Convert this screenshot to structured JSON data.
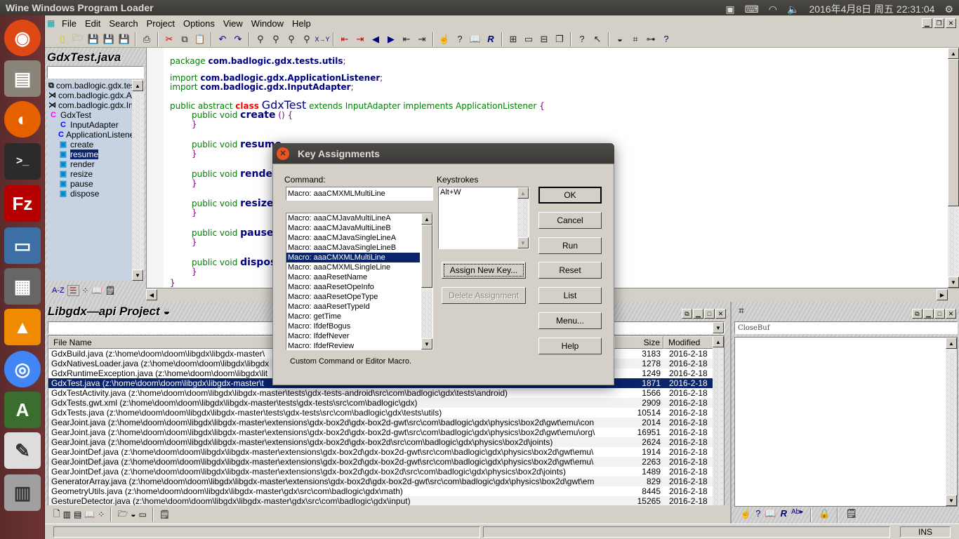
{
  "os": {
    "window_title": "Wine Windows Program Loader",
    "clock": "2016年4月8日 周五 22:31:04",
    "launcher_icons": [
      "ubuntu-dash",
      "files",
      "firefox",
      "terminal",
      "filezilla",
      "remote-desktop",
      "calculator",
      "vlc",
      "chromium",
      "software-updater",
      "text-editor",
      "wine"
    ]
  },
  "menubar": {
    "items": [
      "File",
      "Edit",
      "Search",
      "Project",
      "Options",
      "View",
      "Window",
      "Help"
    ]
  },
  "toolbar": {
    "icons": [
      "new-file",
      "open-folder",
      "save",
      "save-as",
      "save-all",
      "print",
      "cut",
      "copy",
      "paste",
      "undo",
      "redo",
      "find",
      "find-prev",
      "find-next",
      "find-in-files",
      "replace",
      "jump-prev",
      "jump-next",
      "back",
      "forward",
      "outdent",
      "indent",
      "bookmark",
      "help",
      "book",
      "regex",
      "tile",
      "window",
      "split-h",
      "split-v",
      "context-help",
      "pointer",
      "project",
      "relation",
      "hierarchy",
      "info"
    ]
  },
  "symbol_panel": {
    "title": "GdxTest.java",
    "search_value": "",
    "items": [
      {
        "icon": "package",
        "label": "com.badlogic.gdx.tests.utils",
        "indent": 0
      },
      {
        "icon": "import",
        "label": "com.badlogic.gdx.ApplicationListener",
        "indent": 0
      },
      {
        "icon": "import",
        "label": "com.badlogic.gdx.InputAdapter",
        "indent": 0
      },
      {
        "icon": "class-magenta",
        "label": "GdxTest",
        "indent": 0
      },
      {
        "icon": "class",
        "label": "InputAdapter",
        "indent": 1
      },
      {
        "icon": "class",
        "label": "ApplicationListener",
        "indent": 1
      },
      {
        "icon": "method",
        "label": "create",
        "indent": 1
      },
      {
        "icon": "method",
        "label": "resume",
        "indent": 1,
        "selected": true
      },
      {
        "icon": "method",
        "label": "render",
        "indent": 1
      },
      {
        "icon": "method",
        "label": "resize",
        "indent": 1
      },
      {
        "icon": "method",
        "label": "pause",
        "indent": 1
      },
      {
        "icon": "method",
        "label": "dispose",
        "indent": 1
      }
    ],
    "bottom_icons": [
      "sort-az",
      "list-view",
      "categories",
      "book",
      "properties"
    ],
    "sort_label": "A-Z"
  },
  "editor": {
    "package_kw": "package",
    "package_name": "com.badlogic.gdx.tests.utils",
    "import_kw": "import",
    "imports": [
      "com.badlogic.gdx.ApplicationListener",
      "com.badlogic.gdx.InputAdapter"
    ],
    "class_prefix": "public abstract",
    "class_kw": "class",
    "class_name": "GdxTest",
    "class_suffix": "extends InputAdapter implements ApplicationListener",
    "method_prefix": "public void",
    "methods": [
      "create",
      "resume",
      "render",
      "resize",
      "pause",
      "dispose"
    ],
    "first_args": "() {"
  },
  "project_panel": {
    "title": "Libgdx—api Project",
    "filter_value": "",
    "columns": [
      "File Name",
      "Size",
      "Modified"
    ],
    "rows": [
      {
        "name": "GdxBuild.java (z:\\home\\doom\\doom\\libgdx\\libgdx-master\\",
        "size": "3183",
        "modified": "2016-2-18"
      },
      {
        "name": "GdxNativesLoader.java (z:\\home\\doom\\doom\\libgdx\\libgdx",
        "size": "1278",
        "modified": "2016-2-18"
      },
      {
        "name": "GdxRuntimeException.java (z:\\home\\doom\\doom\\libgdx\\lit",
        "size": "1249",
        "modified": "2016-2-18"
      },
      {
        "name": "GdxTest.java (z:\\home\\doom\\doom\\libgdx\\libgdx-master\\t",
        "size": "1871",
        "modified": "2016-2-18",
        "selected": true
      },
      {
        "name": "GdxTestActivity.java (z:\\home\\doom\\doom\\libgdx\\libgdx-master\\tests\\gdx-tests-android\\src\\com\\badlogic\\gdx\\tests\\android)",
        "size": "1566",
        "modified": "2016-2-18"
      },
      {
        "name": "GdxTests.gwt.xml (z:\\home\\doom\\doom\\libgdx\\libgdx-master\\tests\\gdx-tests\\src\\com\\badlogic\\gdx)",
        "size": "2909",
        "modified": "2016-2-18"
      },
      {
        "name": "GdxTests.java (z:\\home\\doom\\doom\\libgdx\\libgdx-master\\tests\\gdx-tests\\src\\com\\badlogic\\gdx\\tests\\utils)",
        "size": "10514",
        "modified": "2016-2-18"
      },
      {
        "name": "GearJoint.java (z:\\home\\doom\\doom\\libgdx\\libgdx-master\\extensions\\gdx-box2d\\gdx-box2d-gwt\\src\\com\\badlogic\\gdx\\physics\\box2d\\gwt\\emu\\con",
        "size": "2014",
        "modified": "2016-2-18"
      },
      {
        "name": "GearJoint.java (z:\\home\\doom\\doom\\libgdx\\libgdx-master\\extensions\\gdx-box2d\\gdx-box2d-gwt\\src\\com\\badlogic\\gdx\\physics\\box2d\\gwt\\emu\\org\\",
        "size": "16951",
        "modified": "2016-2-18"
      },
      {
        "name": "GearJoint.java (z:\\home\\doom\\doom\\libgdx\\libgdx-master\\extensions\\gdx-box2d\\gdx-box2d\\src\\com\\badlogic\\gdx\\physics\\box2d\\joints)",
        "size": "2624",
        "modified": "2016-2-18"
      },
      {
        "name": "GearJointDef.java (z:\\home\\doom\\doom\\libgdx\\libgdx-master\\extensions\\gdx-box2d\\gdx-box2d-gwt\\src\\com\\badlogic\\gdx\\physics\\box2d\\gwt\\emu\\",
        "size": "1914",
        "modified": "2016-2-18"
      },
      {
        "name": "GearJointDef.java (z:\\home\\doom\\doom\\libgdx\\libgdx-master\\extensions\\gdx-box2d\\gdx-box2d-gwt\\src\\com\\badlogic\\gdx\\physics\\box2d\\gwt\\emu\\",
        "size": "2263",
        "modified": "2016-2-18"
      },
      {
        "name": "GearJointDef.java (z:\\home\\doom\\doom\\libgdx\\libgdx-master\\extensions\\gdx-box2d\\gdx-box2d\\src\\com\\badlogic\\gdx\\physics\\box2d\\joints)",
        "size": "1489",
        "modified": "2016-2-18"
      },
      {
        "name": "GeneratorArray.java (z:\\home\\doom\\doom\\libgdx\\libgdx-master\\extensions\\gdx-box2d\\gdx-box2d-gwt\\src\\com\\badlogic\\gdx\\physics\\box2d\\gwt\\em",
        "size": "829",
        "modified": "2016-2-18"
      },
      {
        "name": "GeometryUtils.java (z:\\home\\doom\\doom\\libgdx\\libgdx-master\\gdx\\src\\com\\badlogic\\gdx\\math)",
        "size": "8445",
        "modified": "2016-2-18"
      },
      {
        "name": "GestureDetector.java (z:\\home\\doom\\doom\\libgdx\\libgdx-master\\gdx\\src\\com\\badlogic\\gdx\\input)",
        "size": "15265",
        "modified": "2016-2-18"
      }
    ]
  },
  "right_panel": {
    "field_value": "CloseBuf"
  },
  "status": {
    "mode": "INS"
  },
  "dialog": {
    "title": "Key Assignments",
    "command_label": "Command:",
    "command_value": "Macro: aaaCMXMLMultiLine",
    "keystrokes_label": "Keystrokes",
    "keystrokes": [
      "Alt+W"
    ],
    "commands": [
      "Macro: aaaCMJavaMultiLineA",
      "Macro: aaaCMJavaMultiLineB",
      "Macro: aaaCMJavaSingleLineA",
      "Macro: aaaCMJavaSingleLineB",
      "Macro: aaaCMXMLMultiLine",
      "Macro: aaaCMXMLSingleLine",
      "Macro: aaaResetName",
      "Macro: aaaResetOpeInfo",
      "Macro: aaaResetOpeType",
      "Macro: aaaResetTypeId",
      "Macro: getTime",
      "Macro: IfdefBogus",
      "Macro: IfdefNever",
      "Macro: IfdefReview"
    ],
    "selected_index": 4,
    "description": "Custom Command or Editor Macro.",
    "assign_button": "Assign New Key...",
    "delete_button": "Delete Assignment",
    "buttons": [
      "OK",
      "Cancel",
      "Run",
      "Reset",
      "List",
      "Menu...",
      "Help"
    ]
  }
}
